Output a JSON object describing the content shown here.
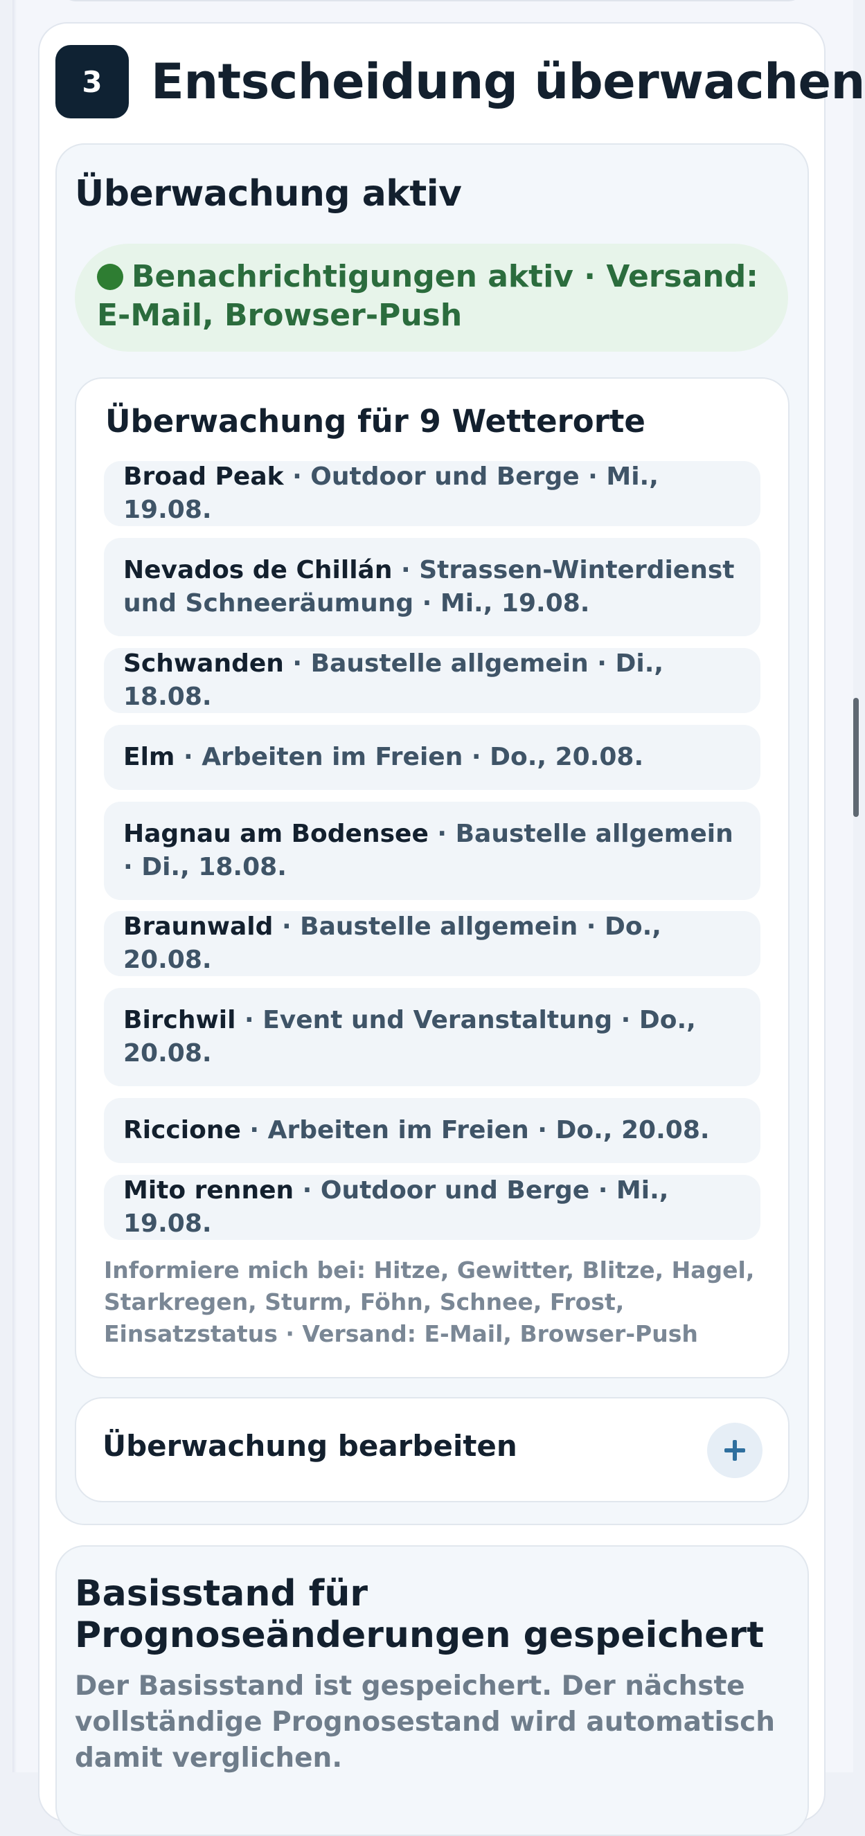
{
  "step": {
    "number": "3",
    "title": "Entscheidung überwachen"
  },
  "monitoring": {
    "title": "Überwachung aktiv",
    "status": "Benachrichtigungen aktiv · Versand: E-Mail, Browser-Push",
    "locations_title": "Überwachung für 9 Wetterorte",
    "locations": [
      {
        "name": "Broad Peak",
        "detail": " · Outdoor und Berge · Mi., 19.08."
      },
      {
        "name": "Nevados de Chillán",
        "detail": " · Strassen-Winterdienst und Schneeräumung · Mi., 19.08."
      },
      {
        "name": "Schwanden",
        "detail": " · Baustelle allgemein · Di., 18.08."
      },
      {
        "name": "Elm",
        "detail": " · Arbeiten im Freien · Do., 20.08."
      },
      {
        "name": "Hagnau am Bodensee",
        "detail": " · Baustelle allgemein · Di., 18.08."
      },
      {
        "name": "Braunwald",
        "detail": " · Baustelle allgemein · Do., 20.08."
      },
      {
        "name": "Birchwil",
        "detail": " · Event und Veranstaltung · Do., 20.08."
      },
      {
        "name": "Riccione",
        "detail": " · Arbeiten im Freien · Do., 20.08."
      },
      {
        "name": "Mito rennen",
        "detail": " · Outdoor und Berge · Mi., 19.08."
      }
    ],
    "info": "Informiere mich bei: Hitze, Gewitter, Blitze, Hagel, Starkregen, Sturm, Föhn, Schnee, Frost, Einsatzstatus · Versand: E-Mail, Browser-Push",
    "edit_label": "Überwachung bearbeiten"
  },
  "baseline": {
    "title": "Basisstand für Prognoseänderungen gespeichert",
    "text": "Der Basisstand ist gespeichert. Der nächste vollständige Prognosestand wird automatisch damit verglichen."
  },
  "colors": {
    "badge_bg": "#0f2233",
    "status_text": "#2b6c3d",
    "status_bg": "#e7f4ea",
    "plus_icon": "#2f6f9e"
  },
  "icons": {
    "status": "status-dot-icon",
    "edit": "plus-icon"
  }
}
